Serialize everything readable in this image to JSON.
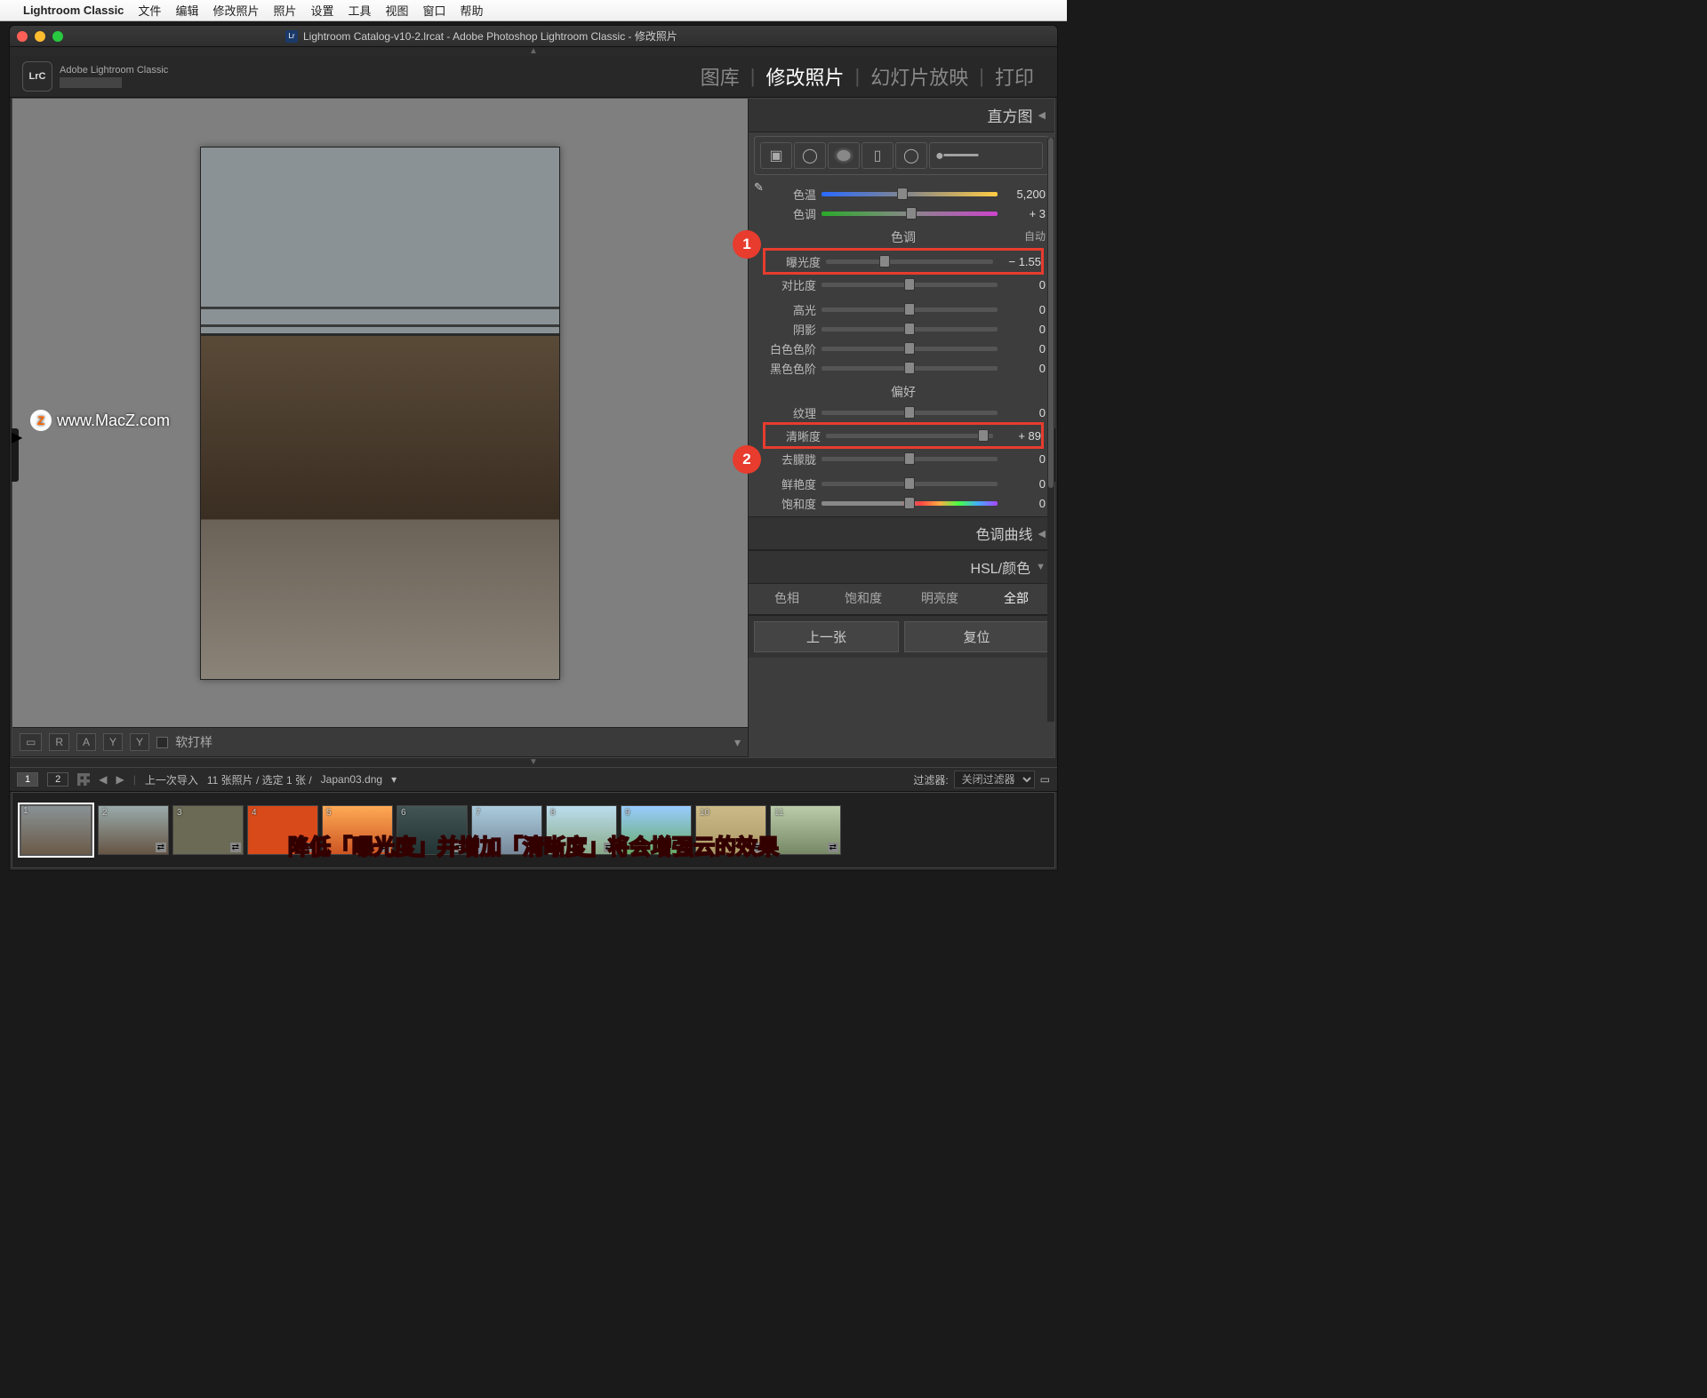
{
  "menubar": {
    "app": "Lightroom Classic",
    "items": [
      "文件",
      "编辑",
      "修改照片",
      "照片",
      "设置",
      "工具",
      "视图",
      "窗口",
      "帮助"
    ]
  },
  "window_title": "Lightroom Catalog-v10-2.lrcat - Adobe Photoshop Lightroom Classic - 修改照片",
  "lrc_badge": "LrC",
  "identity_line": "Adobe Lightroom Classic",
  "modules": {
    "items": [
      "图库",
      "修改照片",
      "幻灯片放映",
      "打印"
    ],
    "active": "修改照片"
  },
  "watermark": "www.MacZ.com",
  "canvas_toolbar": {
    "softproof": "软打样",
    "r": "R",
    "a": "A",
    "y1": "Y",
    "y2": "Y"
  },
  "right": {
    "histogram": "直方图",
    "sections": {
      "tone_header": "色调",
      "auto": "自动",
      "presence_header": "偏好"
    },
    "sliders": {
      "temp": {
        "label": "色温",
        "value": "5,200",
        "pos": 46
      },
      "tint": {
        "label": "色调",
        "value": "+ 3",
        "pos": 51
      },
      "exposure": {
        "label": "曝光度",
        "value": "− 1.55",
        "pos": 35
      },
      "contrast": {
        "label": "对比度",
        "value": "0",
        "pos": 50
      },
      "highlights": {
        "label": "高光",
        "value": "0",
        "pos": 50
      },
      "shadows": {
        "label": "阴影",
        "value": "0",
        "pos": 50
      },
      "whites": {
        "label": "白色色阶",
        "value": "0",
        "pos": 50
      },
      "blacks": {
        "label": "黑色色阶",
        "value": "0",
        "pos": 50
      },
      "texture": {
        "label": "纹理",
        "value": "0",
        "pos": 50
      },
      "clarity": {
        "label": "清晰度",
        "value": "+ 89",
        "pos": 94
      },
      "dehaze": {
        "label": "去朦胧",
        "value": "0",
        "pos": 50
      },
      "vibrance": {
        "label": "鲜艳度",
        "value": "0",
        "pos": 50
      },
      "saturation": {
        "label": "饱和度",
        "value": "0",
        "pos": 50
      }
    },
    "tone_curve": "色调曲线",
    "hsl": "HSL/颜色",
    "hsl_tabs": [
      "色相",
      "饱和度",
      "明亮度",
      "全部"
    ],
    "hsl_active": "全部",
    "prev_btn": "上一张",
    "reset_btn": "复位"
  },
  "annotations": {
    "badge1": "1",
    "badge2": "2"
  },
  "filmstrip_header": {
    "tab1": "1",
    "tab2": "2",
    "context": "上一次导入",
    "count": "11 张照片 / 选定 1 张 /",
    "filename": "Japan03.dng",
    "filter_label": "过滤器:",
    "filter_value": "关闭过滤器"
  },
  "thumbs": [
    "1",
    "2",
    "3",
    "4",
    "5",
    "6",
    "7",
    "8",
    "9",
    "10",
    "11"
  ],
  "caption": "降低「曝光度」并增加「清晰度」将会增强云的效果"
}
